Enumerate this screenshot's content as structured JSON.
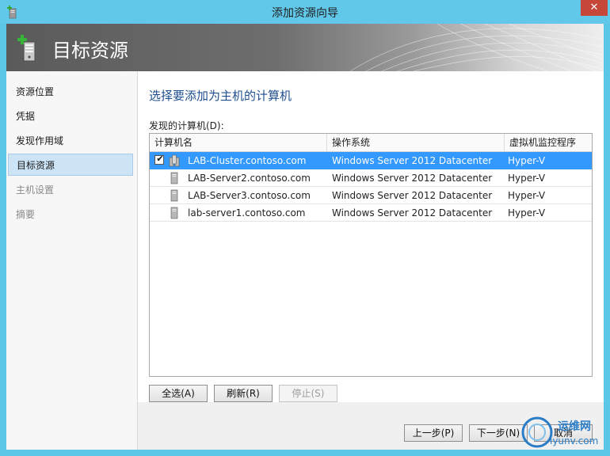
{
  "window": {
    "title": "添加资源向导",
    "close_glyph": "✕"
  },
  "banner": {
    "title": "目标资源",
    "icon": "server-add-icon"
  },
  "nav": {
    "items": [
      {
        "label": "资源位置",
        "state": "normal"
      },
      {
        "label": "凭据",
        "state": "normal"
      },
      {
        "label": "发现作用域",
        "state": "normal"
      },
      {
        "label": "目标资源",
        "state": "active"
      },
      {
        "label": "主机设置",
        "state": "disabled"
      },
      {
        "label": "摘要",
        "state": "disabled"
      }
    ]
  },
  "main": {
    "heading": "选择要添加为主机的计算机",
    "list_label": "发现的计算机(D):",
    "columns": [
      "计算机名",
      "操作系统",
      "虚拟机监控程序"
    ],
    "rows": [
      {
        "checked": true,
        "selected": true,
        "icon": "cluster-icon",
        "name": "LAB-Cluster.contoso.com",
        "os": "Windows Server 2012 Datacenter",
        "hypervisor": "Hyper-V"
      },
      {
        "checked": false,
        "selected": false,
        "icon": "server-icon",
        "name": "LAB-Server2.contoso.com",
        "os": "Windows Server 2012 Datacenter",
        "hypervisor": "Hyper-V"
      },
      {
        "checked": false,
        "selected": false,
        "icon": "server-icon",
        "name": "LAB-Server3.contoso.com",
        "os": "Windows Server 2012 Datacenter",
        "hypervisor": "Hyper-V"
      },
      {
        "checked": false,
        "selected": false,
        "icon": "server-icon",
        "name": "lab-server1.contoso.com",
        "os": "Windows Server 2012 Datacenter",
        "hypervisor": "Hyper-V"
      }
    ],
    "buttons": {
      "select_all": "全选(A)",
      "refresh": "刷新(R)",
      "stop": "停止(S)"
    }
  },
  "footer": {
    "previous": "上一步(P)",
    "next": "下一步(N)",
    "cancel": "取消"
  },
  "watermark": {
    "text": "运维网",
    "url": "iyunv.com"
  },
  "colors": {
    "selection": "#3399ff",
    "title_bar": "#62c8ea",
    "heading": "#1f4f8f",
    "close": "#c7463a"
  }
}
